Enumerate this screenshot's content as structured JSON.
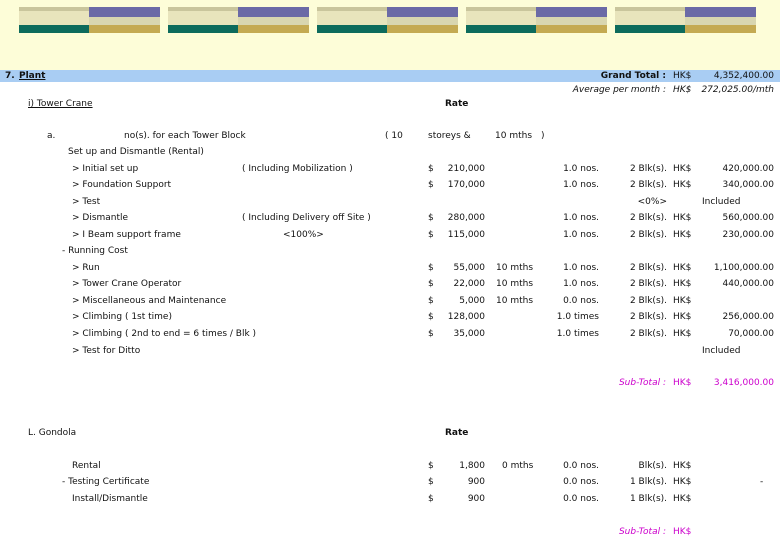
{
  "section": {
    "number": "7.",
    "title": "Plant",
    "grand_total_label": "Grand Total :",
    "grand_total_currency": "HK$",
    "grand_total_value": "4,352,400.00",
    "avg_label": "Average per month :",
    "avg_currency": "HK$",
    "avg_value": "272,025.00/mth"
  },
  "tower_crane": {
    "heading": "i) Tower Crane",
    "rate_label": "Rate",
    "sub_a_label": "a.",
    "sub_a_desc": "no(s). for each Tower Block",
    "sub_a_storeys_open": "( 10",
    "sub_a_storeys": "storeys &",
    "sub_a_mths": "10 mths",
    "sub_a_close": ")",
    "setup_heading": "Set up and Dismantle (Rental)",
    "running_heading": "- Running Cost",
    "subtotal_label": "Sub-Total :",
    "subtotal_currency": "HK$",
    "subtotal_value": "3,416,000.00",
    "rows": [
      {
        "desc": "> Initial set up",
        "note": "( Including Mobilization )",
        "cur1": "$",
        "rate": "210,000",
        "mths": "",
        "qty": "1.0 nos.",
        "blk": "2 Blk(s).",
        "cur2": "HK$",
        "amount": "420,000.00"
      },
      {
        "desc": "> Foundation Support",
        "note": "",
        "cur1": "$",
        "rate": "170,000",
        "mths": "",
        "qty": "1.0 nos.",
        "blk": "2 Blk(s).",
        "cur2": "HK$",
        "amount": "340,000.00"
      },
      {
        "desc": "> Test",
        "note": "",
        "cur1": "",
        "rate": "",
        "mths": "",
        "qty": "",
        "blk": "<0%>",
        "cur2": "",
        "amount": "Included"
      },
      {
        "desc": "> Dismantle",
        "note": "( Including Delivery off Site )",
        "cur1": "$",
        "rate": "280,000",
        "mths": "",
        "qty": "1.0 nos.",
        "blk": "2 Blk(s).",
        "cur2": "HK$",
        "amount": "560,000.00"
      },
      {
        "desc": "> I Beam support frame",
        "note": "<100%>",
        "cur1": "$",
        "rate": "115,000",
        "mths": "",
        "qty": "1.0 nos.",
        "blk": "2 Blk(s).",
        "cur2": "HK$",
        "amount": "230,000.00"
      },
      {
        "desc": "> Run",
        "note": "",
        "cur1": "$",
        "rate": "55,000",
        "mths": "10 mths",
        "qty": "1.0 nos.",
        "blk": "2 Blk(s).",
        "cur2": "HK$",
        "amount": "1,100,000.00"
      },
      {
        "desc": "> Tower Crane Operator",
        "note": "",
        "cur1": "$",
        "rate": "22,000",
        "mths": "10 mths",
        "qty": "1.0 nos.",
        "blk": "2 Blk(s).",
        "cur2": "HK$",
        "amount": "440,000.00"
      },
      {
        "desc": "> Miscellaneous and Maintenance",
        "note": "",
        "cur1": "$",
        "rate": "5,000",
        "mths": "10 mths",
        "qty": "0.0 nos.",
        "blk": "2 Blk(s).",
        "cur2": "HK$",
        "amount": ""
      },
      {
        "desc": "> Climbing ( 1st time)",
        "note": "",
        "cur1": "$",
        "rate": "128,000",
        "mths": "",
        "qty": "1.0 times",
        "blk": "2 Blk(s).",
        "cur2": "HK$",
        "amount": "256,000.00"
      },
      {
        "desc": "> Climbing ( 2nd to end = 6 times / Blk )",
        "note": "",
        "cur1": "$",
        "rate": "35,000",
        "mths": "",
        "qty": "1.0 times",
        "blk": "2 Blk(s).",
        "cur2": "HK$",
        "amount": "70,000.00"
      },
      {
        "desc": "> Test for Ditto",
        "note": "",
        "cur1": "",
        "rate": "",
        "mths": "",
        "qty": "",
        "blk": "",
        "cur2": "",
        "amount": "Included"
      }
    ]
  },
  "gondola": {
    "heading": "L. Gondola",
    "rate_label": "Rate",
    "subtotal_label": "Sub-Total :",
    "subtotal_currency": "HK$",
    "rows": [
      {
        "desc": "Rental",
        "cur1": "$",
        "rate": "1,800",
        "mths": "0 mths",
        "qty": "0.0 nos.",
        "blk": "Blk(s).",
        "cur2": "HK$",
        "amount": ""
      },
      {
        "desc": "- Testing Certificate",
        "cur1": "$",
        "rate": "900",
        "mths": "",
        "qty": "0.0 nos.",
        "blk": "1 Blk(s).",
        "cur2": "HK$",
        "amount": "-"
      },
      {
        "desc": "Install/Dismantle",
        "cur1": "$",
        "rate": "900",
        "mths": "",
        "qty": "0.0 nos.",
        "blk": "1 Blk(s).",
        "cur2": "HK$",
        "amount": ""
      }
    ]
  },
  "colors": {
    "top_band": "#fdfdd8",
    "header_bar": "#a9cdf3",
    "subtotal": "#cc00cc",
    "logo_purple": "#6b6aa6",
    "logo_teal": "#0d6b5c",
    "logo_gold": "#c4aa52"
  }
}
